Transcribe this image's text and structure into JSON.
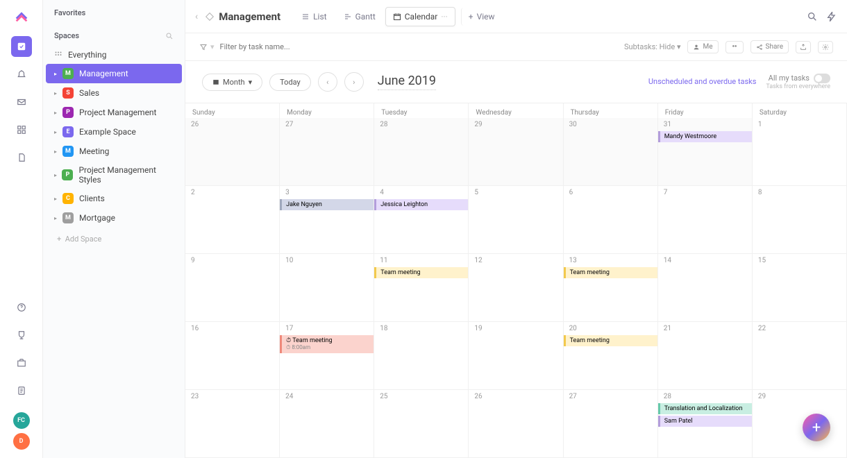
{
  "sidebar": {
    "favorites_label": "Favorites",
    "spaces_label": "Spaces",
    "everything_label": "Everything",
    "add_space_label": "Add Space",
    "spaces": [
      {
        "letter": "M",
        "color": "#4caf50",
        "label": "Management",
        "selected": true
      },
      {
        "letter": "S",
        "color": "#f44336",
        "label": "Sales"
      },
      {
        "letter": "P",
        "color": "#9c27b0",
        "label": "Project Management"
      },
      {
        "letter": "E",
        "color": "#7b68ee",
        "label": "Example Space"
      },
      {
        "letter": "M",
        "color": "#2196f3",
        "label": "Meeting"
      },
      {
        "letter": "P",
        "color": "#4caf50",
        "label": "Project Management Styles"
      },
      {
        "letter": "C",
        "color": "#ffb300",
        "label": "Clients"
      },
      {
        "letter": "M",
        "color": "#9e9e9e",
        "label": "Mortgage"
      }
    ]
  },
  "avatars": [
    {
      "label": "FC",
      "color": "#26a69a"
    },
    {
      "label": "D",
      "color": "#ff7043"
    }
  ],
  "topbar": {
    "title": "Management",
    "tabs": {
      "list": "List",
      "gantt": "Gantt",
      "calendar": "Calendar",
      "view": "View"
    }
  },
  "filterbar": {
    "placeholder": "Filter by task name...",
    "subtasks_label": "Subtasks:",
    "subtasks_value": "Hide",
    "me_label": "Me",
    "share_label": "Share"
  },
  "controls": {
    "range": "Month",
    "today": "Today",
    "title": "June 2019",
    "unscheduled": "Unscheduled and overdue tasks",
    "alltasks": "All my tasks",
    "alltasks_sub": "Tasks from everywhere"
  },
  "calendar": {
    "days": [
      "Sunday",
      "Monday",
      "Tuesday",
      "Wednesday",
      "Thursday",
      "Friday",
      "Saturday"
    ],
    "weeks": [
      [
        {
          "date": "26",
          "other": true
        },
        {
          "date": "27",
          "other": true
        },
        {
          "date": "28",
          "other": true
        },
        {
          "date": "29",
          "other": true
        },
        {
          "date": "30",
          "other": true
        },
        {
          "date": "31",
          "other": true,
          "events": [
            {
              "label": "Mandy Westmoore",
              "bg": "#e6dcfb",
              "border": "#b39ddb"
            }
          ]
        },
        {
          "date": "1"
        }
      ],
      [
        {
          "date": "2"
        },
        {
          "date": "3",
          "events": [
            {
              "label": "Jake Nguyen",
              "bg": "#d3d7e8",
              "border": "#9fa8bd"
            }
          ]
        },
        {
          "date": "4",
          "events": [
            {
              "label": "Jessica Leighton",
              "bg": "#e6dcfb",
              "border": "#b39ddb"
            }
          ]
        },
        {
          "date": "5"
        },
        {
          "date": "6"
        },
        {
          "date": "7"
        },
        {
          "date": "8"
        }
      ],
      [
        {
          "date": "9"
        },
        {
          "date": "10"
        },
        {
          "date": "11",
          "events": [
            {
              "label": "Team meeting",
              "bg": "#fff2cc",
              "border": "#f2c94c"
            }
          ]
        },
        {
          "date": "12"
        },
        {
          "date": "13",
          "events": [
            {
              "label": "Team meeting",
              "bg": "#fff2cc",
              "border": "#f2c94c"
            }
          ]
        },
        {
          "date": "14"
        },
        {
          "date": "15"
        }
      ],
      [
        {
          "date": "16"
        },
        {
          "date": "17",
          "events": [
            {
              "label": "Team meeting",
              "time": "8:00am",
              "bg": "#fbd3cd",
              "border": "#ef897b"
            }
          ]
        },
        {
          "date": "18"
        },
        {
          "date": "19"
        },
        {
          "date": "20",
          "events": [
            {
              "label": "Team meeting",
              "bg": "#fff2cc",
              "border": "#f2c94c"
            }
          ]
        },
        {
          "date": "21"
        },
        {
          "date": "22"
        }
      ],
      [
        {
          "date": "23"
        },
        {
          "date": "24"
        },
        {
          "date": "25"
        },
        {
          "date": "26"
        },
        {
          "date": "27"
        },
        {
          "date": "28",
          "events": [
            {
              "label": "Translation and Localization",
              "bg": "#c8eee2",
              "border": "#66c9aa"
            },
            {
              "label": "Sam Patel",
              "bg": "#e6dcfb",
              "border": "#b39ddb"
            }
          ]
        },
        {
          "date": "29"
        }
      ]
    ]
  }
}
